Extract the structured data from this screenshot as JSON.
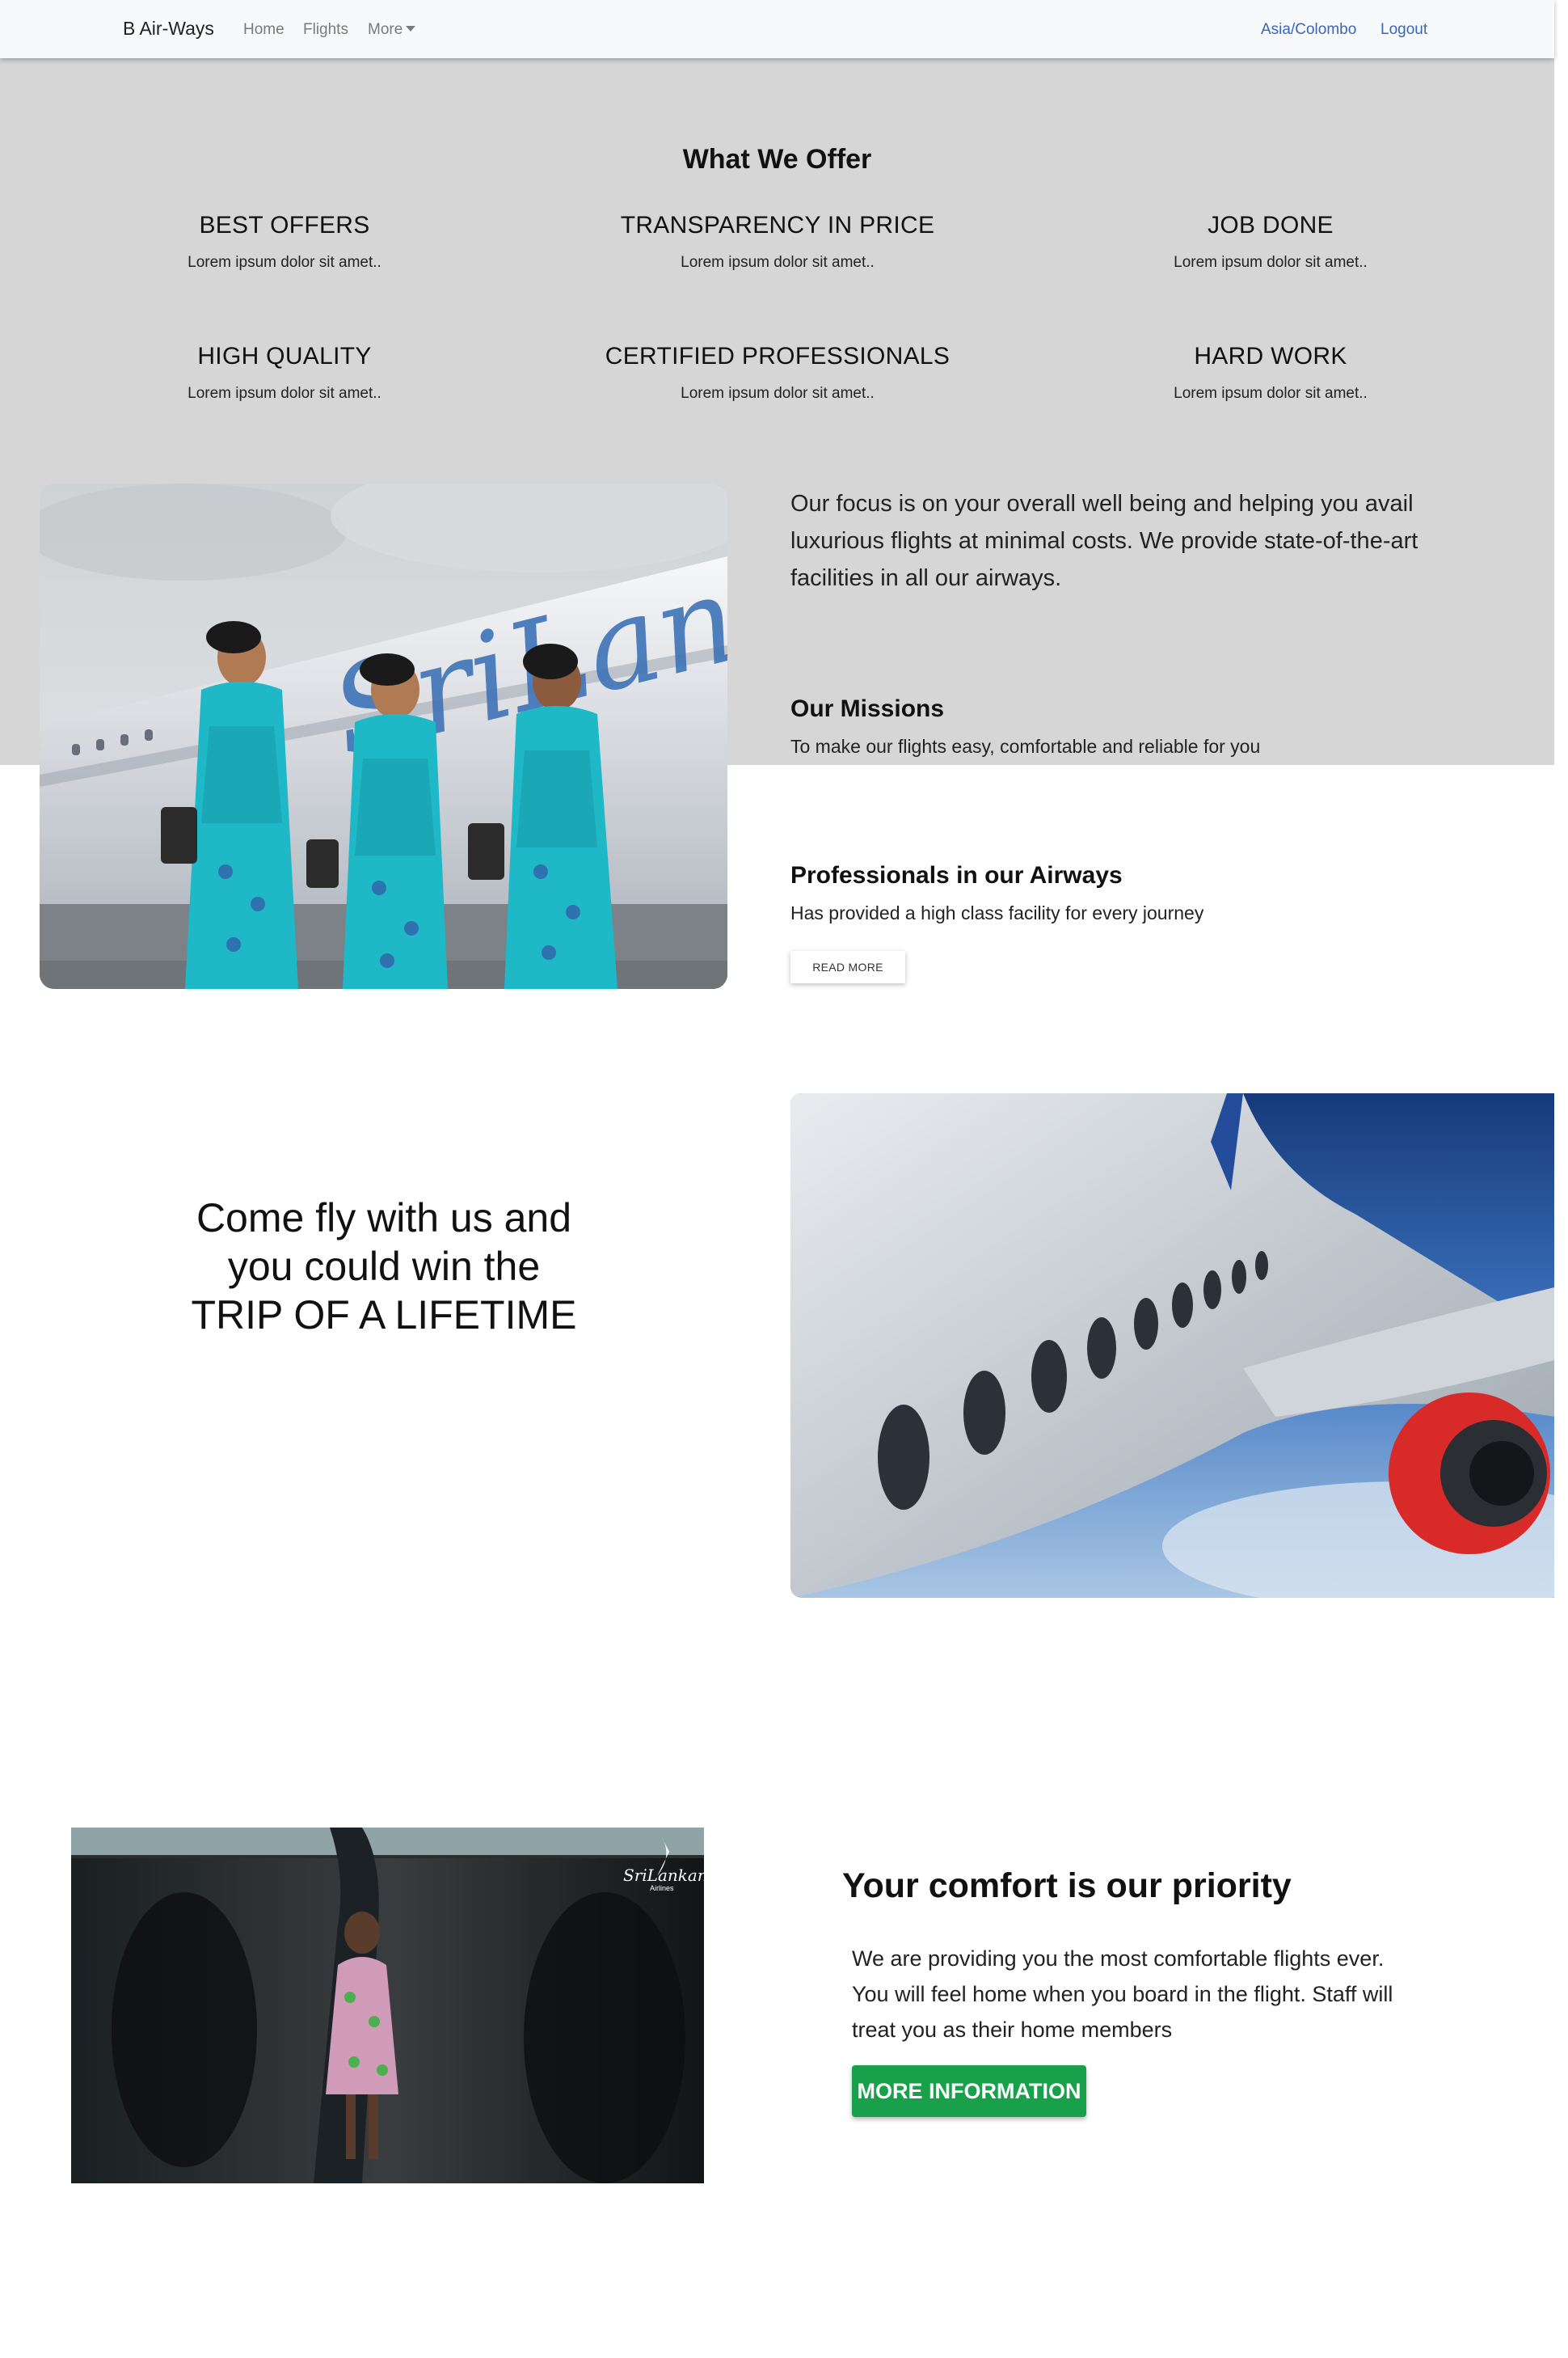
{
  "navbar": {
    "brand": "B Air-Ways",
    "links": {
      "home": "Home",
      "flights": "Flights",
      "more": "More"
    },
    "right": {
      "timezone": "Asia/Colombo",
      "logout": "Logout"
    }
  },
  "offers": {
    "title": "What We Offer",
    "items": [
      {
        "title": "BEST OFFERS",
        "text": "Lorem ipsum dolor sit amet.."
      },
      {
        "title": "TRANSPARENCY IN PRICE",
        "text": "Lorem ipsum dolor sit amet.."
      },
      {
        "title": "JOB DONE",
        "text": "Lorem ipsum dolor sit amet.."
      },
      {
        "title": "HIGH QUALITY",
        "text": "Lorem ipsum dolor sit amet.."
      },
      {
        "title": "CERTIFIED PROFESSIONALS",
        "text": "Lorem ipsum dolor sit amet.."
      },
      {
        "title": "HARD WORK",
        "text": "Lorem ipsum dolor sit amet.."
      }
    ]
  },
  "about": {
    "focus": "Our focus is on your overall well being and helping you avail luxurious flights at minimal costs. We provide state-of-the-art facilities in all our airways.",
    "missions_title": "Our Missions",
    "missions_text": "To make our flights easy, comfortable and reliable for you",
    "professionals_title": "Professionals in our Airways",
    "professionals_text": "Has provided a high class facility for every journey",
    "read_more": "READ MORE",
    "image_logo_text": "SriLankan"
  },
  "promo": {
    "line1": "Come fly with us and",
    "line2": "you could win the",
    "line3": "TRIP OF A LIFETIME"
  },
  "comfort": {
    "title": "Your comfort is our priority",
    "text": "We are providing you the most comfortable flights ever. You will feel home when you board in the flight. Staff will treat you as their home members",
    "button": "MORE INFORMATION",
    "video_logo": "SriLankan",
    "video_logo_sub": "Airlines"
  },
  "colors": {
    "grey_band": "#d6d6d6",
    "link_blue": "#3a67b5",
    "button_green": "#18a04a",
    "uniform_teal": "#1fb8c7"
  }
}
